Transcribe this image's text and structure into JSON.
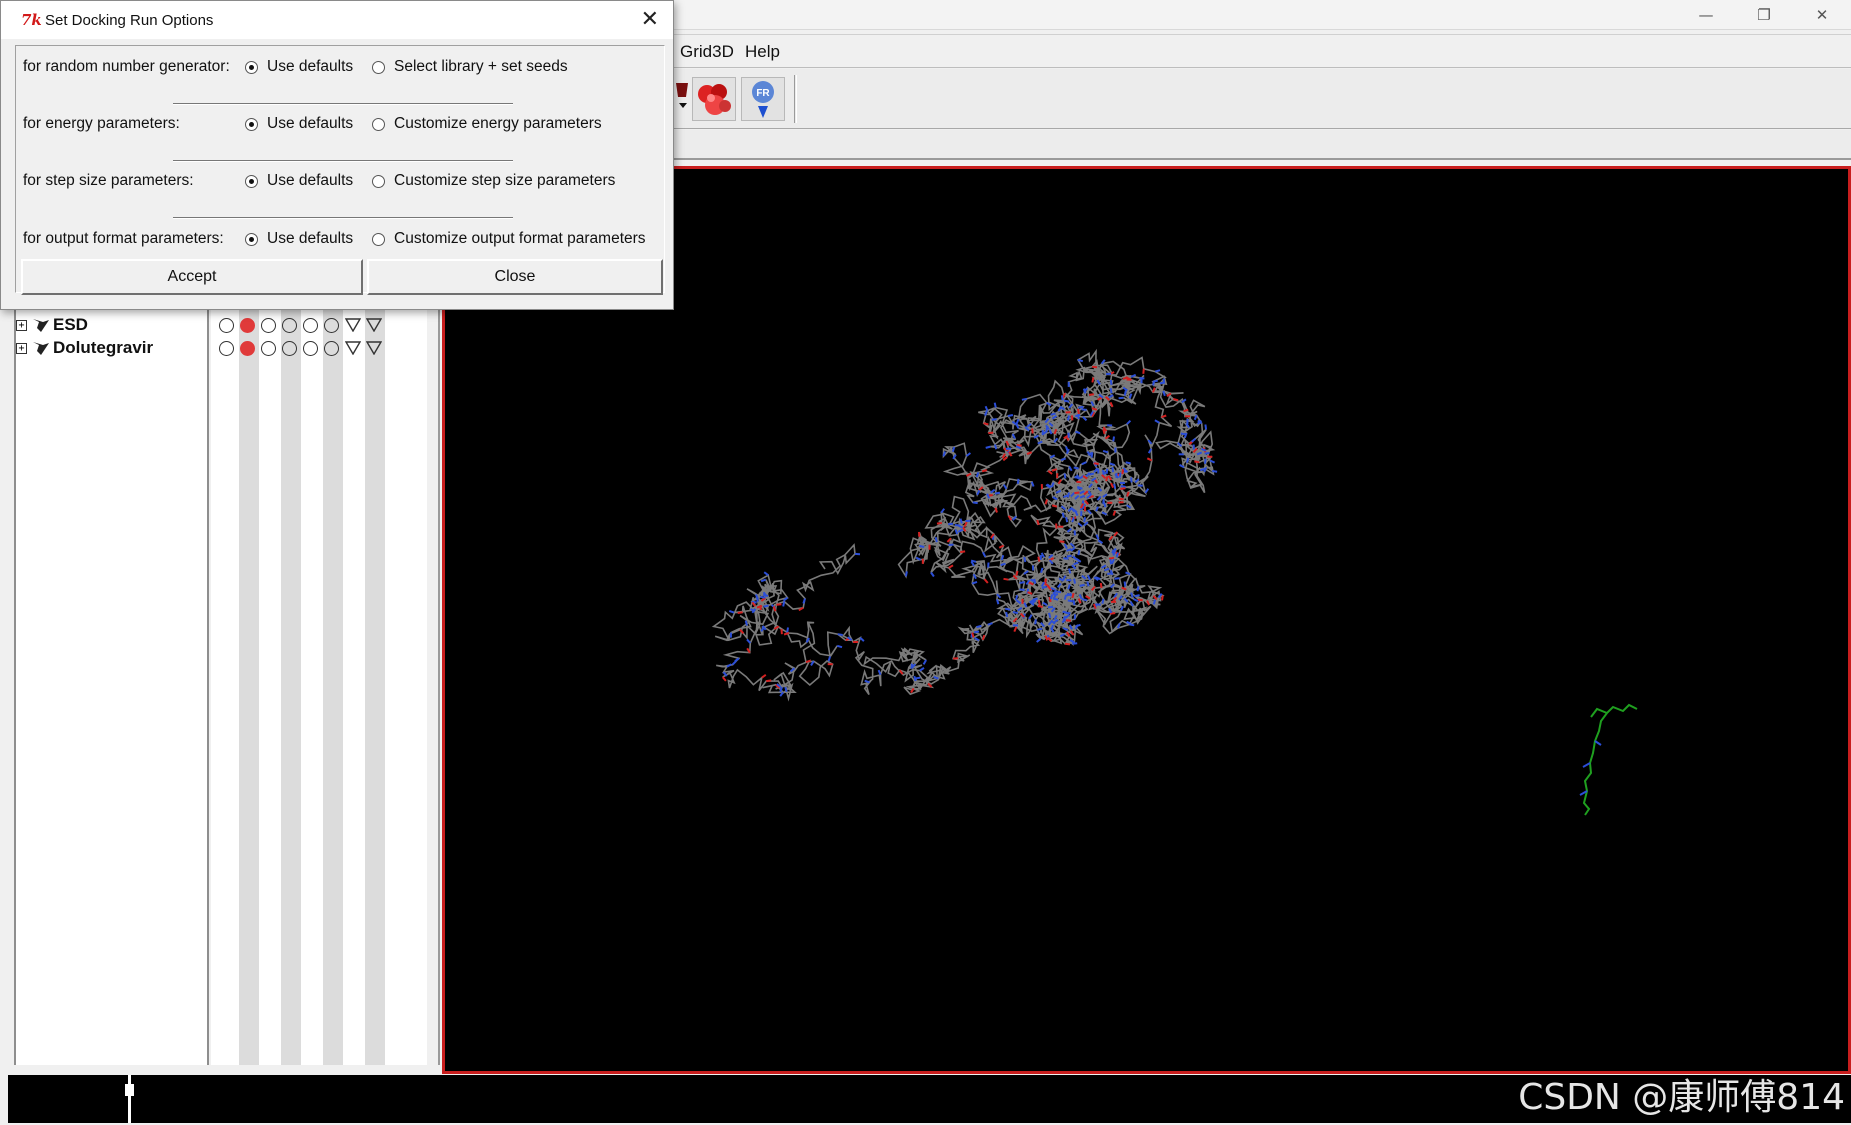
{
  "window": {
    "controls": {
      "minimize": "—",
      "restore": "❐",
      "close": "✕"
    }
  },
  "menubar": {
    "items": [
      "Grid3D",
      "Help"
    ]
  },
  "toolbar": {
    "icons": [
      "dropdown-icon",
      "molecule-surface-icon",
      "flag-pin-icon"
    ]
  },
  "molecules": [
    {
      "name": "ESD",
      "expand": "+",
      "visibility": [
        "empty",
        "red",
        "empty",
        "empty",
        "empty",
        "empty",
        "triangle",
        "triangle"
      ]
    },
    {
      "name": "Dolutegravir",
      "expand": "+",
      "visibility": [
        "empty",
        "red",
        "empty",
        "empty",
        "empty",
        "empty",
        "triangle",
        "triangle"
      ]
    }
  ],
  "dialog": {
    "title": "Set Docking Run Options",
    "close_glyph": "✕",
    "rows": [
      {
        "label": "for random number generator:",
        "default_option": "Use defaults",
        "custom_option": "Select library + set seeds",
        "selected": "default"
      },
      {
        "label": "for energy parameters:",
        "default_option": "Use defaults",
        "custom_option": "Customize energy parameters",
        "selected": "default"
      },
      {
        "label": "for step size parameters:",
        "default_option": "Use defaults",
        "custom_option": "Customize step size parameters",
        "selected": "default"
      },
      {
        "label": "for output format parameters:",
        "default_option": "Use defaults",
        "custom_option": "Customize output format parameters",
        "selected": "default"
      }
    ],
    "accept_label": "Accept",
    "close_label": "Close"
  },
  "viewer": {
    "background": "#000000",
    "border_color": "#c81e1e",
    "atom_colors": {
      "carbon": "#7a7a7a",
      "nitrogen": "#2b4ed8",
      "oxygen": "#d42020",
      "ligand": "#1fa01f"
    }
  },
  "watermark": "CSDN @康师傅814"
}
